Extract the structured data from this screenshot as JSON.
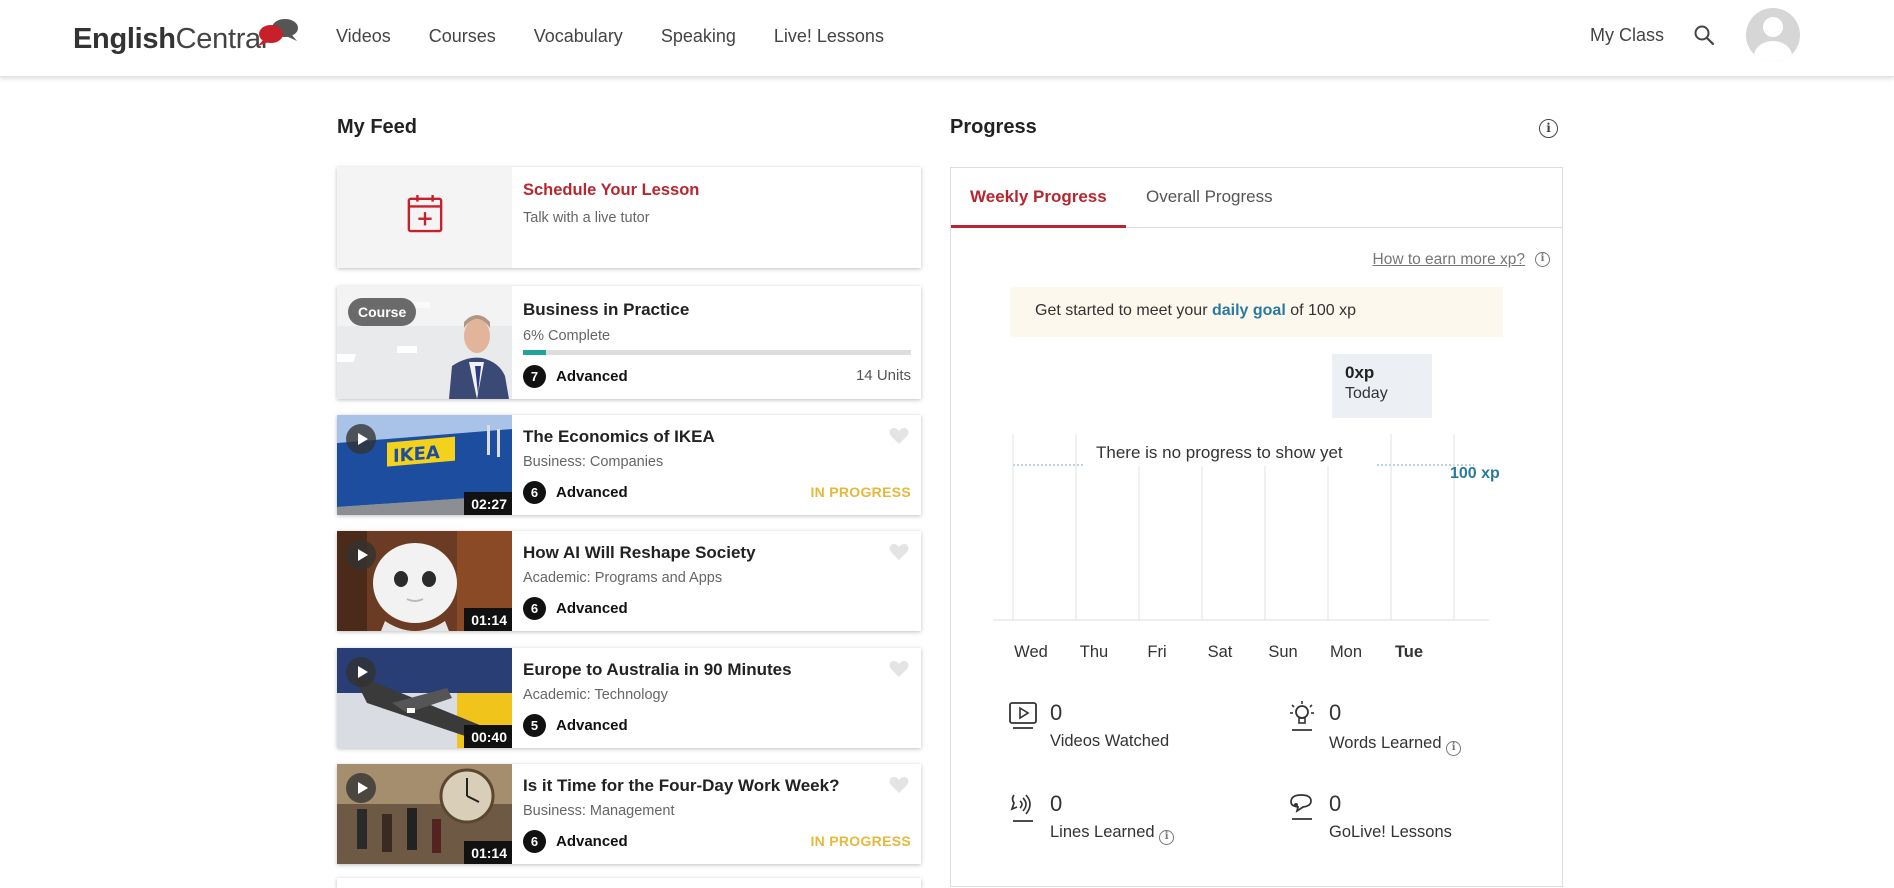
{
  "header": {
    "logo_part1": "English",
    "logo_part2": "Central",
    "nav": [
      "Videos",
      "Courses",
      "Vocabulary",
      "Speaking",
      "Live! Lessons"
    ],
    "my_class": "My Class",
    "icons": [
      "search-icon",
      "avatar-icon"
    ]
  },
  "feed": {
    "title": "My Feed",
    "schedule": {
      "title": "Schedule Your Lesson",
      "subtitle": "Talk with a live tutor",
      "title_color": "#b8262f"
    },
    "course": {
      "badge": "Course",
      "title": "Business in Practice",
      "progress_text": "6% Complete",
      "progress_fraction": 0.06,
      "level_num": "7",
      "level": "Advanced",
      "units": "14 Units"
    },
    "videos": [
      {
        "title": "The Economics of IKEA",
        "category": "Business: Companies",
        "level_num": "6",
        "level": "Advanced",
        "duration": "02:27",
        "status": "IN PROGRESS"
      },
      {
        "title": "How AI Will Reshape Society",
        "category": "Academic: Programs and Apps",
        "level_num": "6",
        "level": "Advanced",
        "duration": "01:14",
        "status": ""
      },
      {
        "title": "Europe to Australia in 90 Minutes",
        "category": "Academic: Technology",
        "level_num": "5",
        "level": "Advanced",
        "duration": "00:40",
        "status": ""
      },
      {
        "title": "Is it Time for the Four-Day Work Week?",
        "category": "Business: Management",
        "level_num": "6",
        "level": "Advanced",
        "duration": "01:14",
        "status": "IN PROGRESS"
      }
    ]
  },
  "progress": {
    "title": "Progress",
    "tabs": [
      "Weekly Progress",
      "Overall Progress"
    ],
    "earn_link": "How to earn more xp?",
    "goal_prefix": "Get started to meet your ",
    "goal_link": "daily goal",
    "goal_suffix": " of 100 xp",
    "today_xp": "0xp",
    "today_label": "Today",
    "empty_msg": "There is no progress to show yet",
    "goal_label": "100 xp",
    "accent": "#b8262f",
    "link_color": "#2a7aa0"
  },
  "chart_data": {
    "type": "bar",
    "categories": [
      "Wed",
      "Thu",
      "Fri",
      "Sat",
      "Sun",
      "Mon",
      "Tue"
    ],
    "values": [
      0,
      0,
      0,
      0,
      0,
      0,
      0
    ],
    "goal": 100,
    "title": "",
    "xlabel": "",
    "ylabel": "",
    "highlight": "Tue"
  },
  "stats": [
    {
      "icon": "video-icon",
      "value": "0",
      "label": "Videos Watched",
      "info": false
    },
    {
      "icon": "lightbulb-icon",
      "value": "0",
      "label": "Words Learned",
      "info": true
    },
    {
      "icon": "speech-icon",
      "value": "0",
      "label": "Lines Learned",
      "info": true
    },
    {
      "icon": "chat-icon",
      "value": "0",
      "label": "GoLive! Lessons",
      "info": false
    }
  ]
}
